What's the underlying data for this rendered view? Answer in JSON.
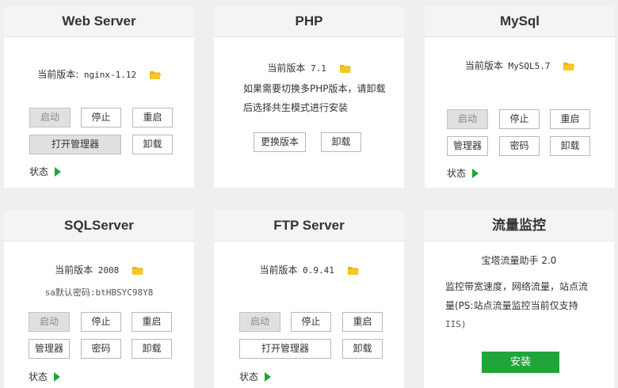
{
  "cards": {
    "web": {
      "title": "Web Server",
      "version_label": "当前版本:",
      "version_value": "nginx-1.12",
      "start": "启动",
      "stop": "停止",
      "restart": "重启",
      "manager": "打开管理器",
      "uninstall": "卸载",
      "status": "状态"
    },
    "php": {
      "title": "PHP",
      "version_label": "当前版本",
      "version_value": "7.1",
      "note_line1": "如果需要切换多PHP版本，请卸载",
      "note_line2": "后选择共生模式进行安装",
      "change": "更换版本",
      "uninstall": "卸载"
    },
    "mysql": {
      "title": "MySql",
      "version_label": "当前版本",
      "version_value": "MySQL5.7",
      "start": "启动",
      "stop": "停止",
      "restart": "重启",
      "manager": "管理器",
      "password": "密码",
      "uninstall": "卸载",
      "status": "状态"
    },
    "sqlserver": {
      "title": "SQLServer",
      "version_label": "当前版本",
      "version_value": "2008",
      "password_note": "sa默认密码:btHBSYC98Y8",
      "start": "启动",
      "stop": "停止",
      "restart": "重启",
      "manager": "管理器",
      "password": "密码",
      "uninstall": "卸载",
      "status": "状态"
    },
    "ftp": {
      "title": "FTP Server",
      "version_label": "当前版本",
      "version_value": "0.9.41",
      "start": "启动",
      "stop": "停止",
      "restart": "重启",
      "manager": "打开管理器",
      "uninstall": "卸载",
      "status": "状态"
    },
    "traffic": {
      "title": "流量监控",
      "plugin": "宝塔流量助手 2.0",
      "desc_line1": "监控带宽速度，网络流量，站点流",
      "desc_line2": "量(PS:站点流量监控当前仅支持",
      "desc_line3": "IIS)",
      "install": "安装"
    }
  },
  "colors": {
    "accent_green": "#20a53a",
    "folder_yellow": "#f0b400",
    "page_bg": "#efefef"
  },
  "icons": {
    "folder": "folder-icon",
    "status": "play-triangle-icon"
  }
}
